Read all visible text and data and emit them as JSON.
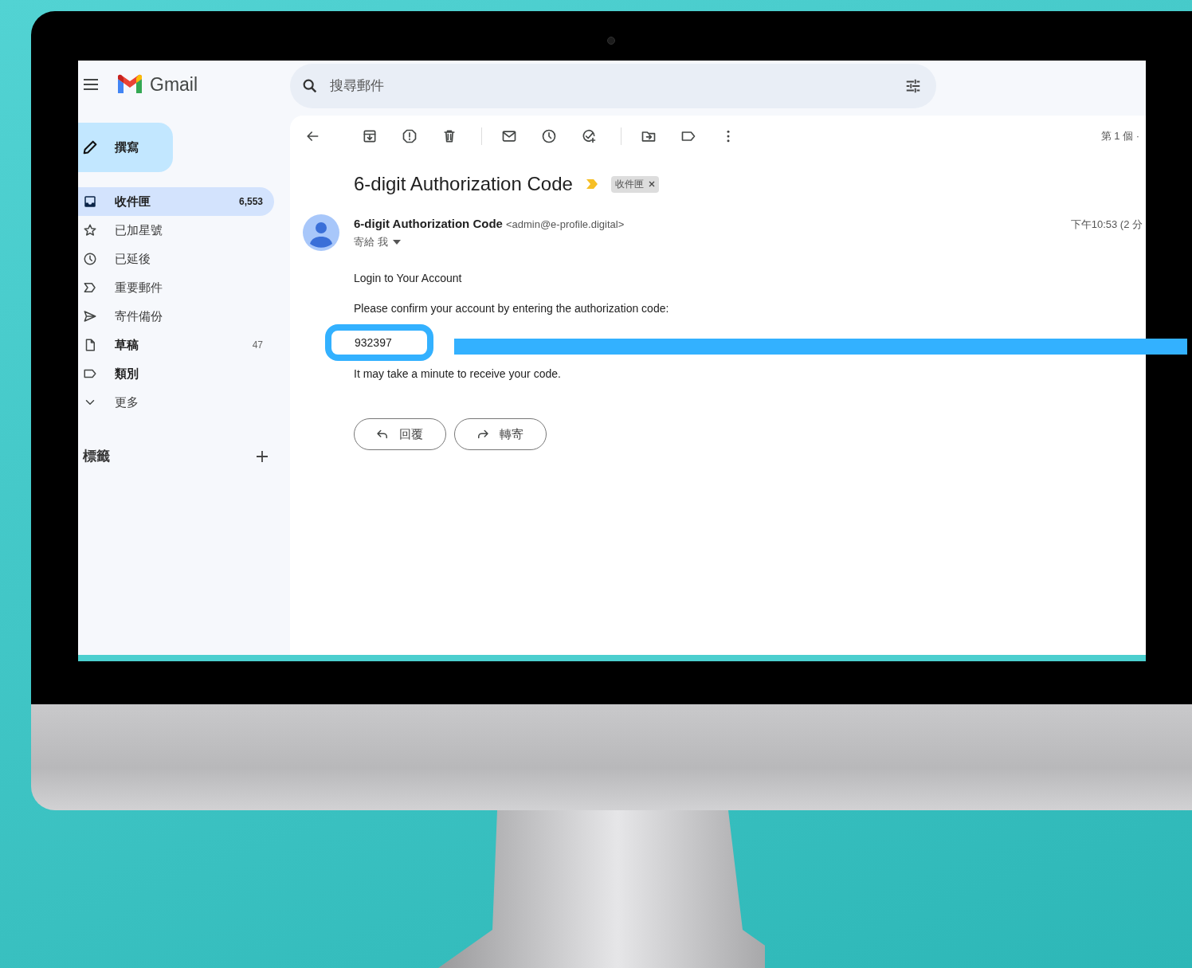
{
  "header": {
    "app_name": "Gmail",
    "search": {
      "placeholder": "搜尋郵件"
    }
  },
  "compose": {
    "label": "撰寫"
  },
  "sidebar": {
    "items": [
      {
        "kind": "inbox",
        "label": "收件匣",
        "count": "6,553",
        "selected": true,
        "unread": true
      },
      {
        "kind": "starred",
        "label": "已加星號",
        "selected": false,
        "unread": false
      },
      {
        "kind": "snoozed",
        "label": "已延後",
        "selected": false,
        "unread": false
      },
      {
        "kind": "important",
        "label": "重要郵件",
        "selected": false,
        "unread": false
      },
      {
        "kind": "sent",
        "label": "寄件備份",
        "selected": false,
        "unread": false
      },
      {
        "kind": "drafts",
        "label": "草稿",
        "count": "47",
        "selected": false,
        "unread": true
      },
      {
        "kind": "categories",
        "label": "類別",
        "selected": false,
        "unread": true
      },
      {
        "kind": "more",
        "label": "更多",
        "selected": false,
        "unread": false
      }
    ],
    "labels_heading": "標籤"
  },
  "toolbar": {
    "pager": "第 1 個 ·"
  },
  "message": {
    "subject": "6-digit Authorization Code",
    "tag": "收件匣",
    "sender_name": "6-digit Authorization Code",
    "sender_email": "<admin@e-profile.digital>",
    "recipient": "寄給 我",
    "time": "下午10:53 (2 分",
    "greeting": "Login to Your Account",
    "instruction": "Please confirm your account by entering the authorization code:",
    "code": "932397",
    "code_highlighted": true,
    "note": "It may take a minute to receive your code."
  },
  "actions": [
    {
      "kind": "reply",
      "label": "回覆"
    },
    {
      "kind": "forward",
      "label": "轉寄"
    }
  ]
}
